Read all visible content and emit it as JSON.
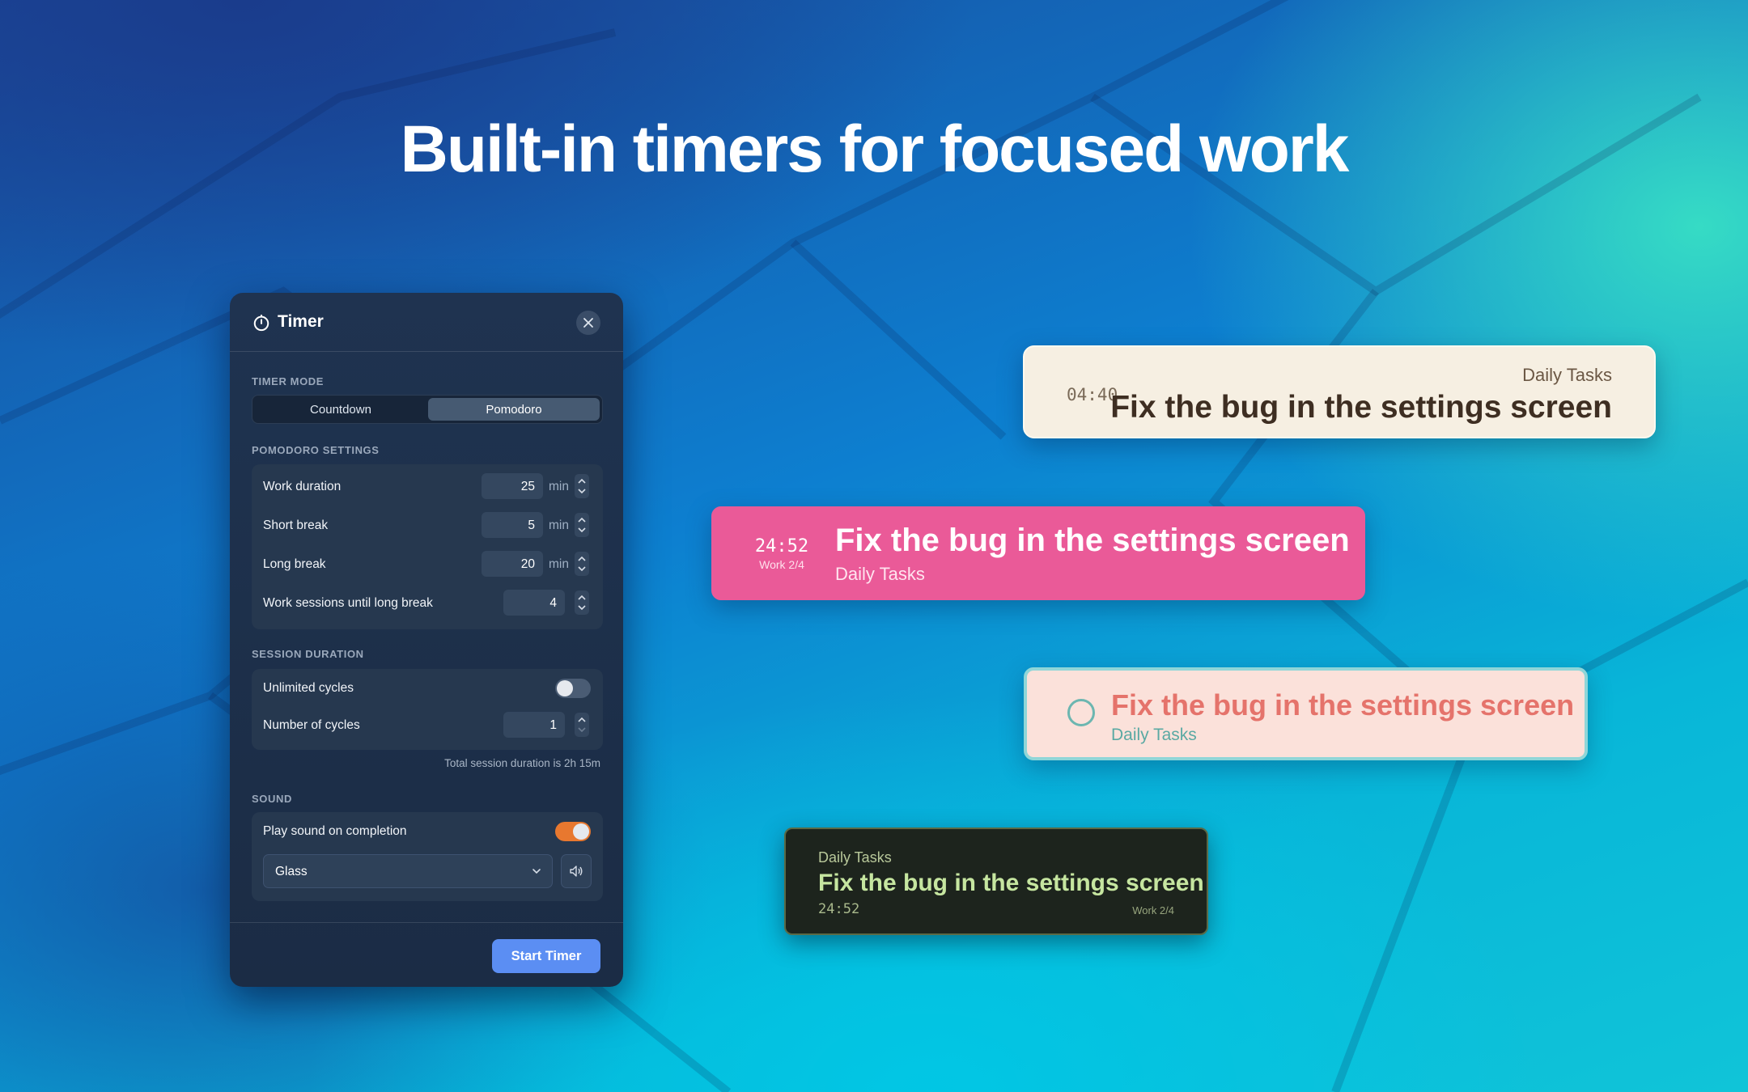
{
  "headline": "Built-in timers for focused work",
  "panel": {
    "title": "Timer",
    "mode_label": "TIMER MODE",
    "modes": [
      "Countdown",
      "Pomodoro"
    ],
    "active_mode": "Pomodoro",
    "pomodoro_label": "POMODORO SETTINGS",
    "work_duration": {
      "label": "Work duration",
      "value": "25",
      "unit": "min"
    },
    "short_break": {
      "label": "Short break",
      "value": "5",
      "unit": "min"
    },
    "long_break": {
      "label": "Long break",
      "value": "20",
      "unit": "min"
    },
    "sessions": {
      "label": "Work sessions until long break",
      "value": "4"
    },
    "session_label": "SESSION DURATION",
    "unlimited": {
      "label": "Unlimited cycles",
      "on": false
    },
    "cycles": {
      "label": "Number of cycles",
      "value": "1"
    },
    "total_hint": "Total session duration is 2h 15m",
    "sound_label": "SOUND",
    "play_sound": {
      "label": "Play sound on completion",
      "on": true
    },
    "sound_choice": "Glass",
    "start_button": "Start Timer"
  },
  "cards": {
    "cream": {
      "timer": "04:40",
      "list": "Daily Tasks",
      "task": "Fix the bug in the settings screen"
    },
    "pink": {
      "timer": "24:52",
      "sub": "Work 2/4",
      "task": "Fix the bug in the settings screen",
      "list": "Daily Tasks"
    },
    "peach": {
      "task": "Fix the bug in the settings screen",
      "list": "Daily Tasks"
    },
    "dark": {
      "list": "Daily Tasks",
      "task": "Fix the bug in the settings screen",
      "timer": "24:52",
      "sub": "Work 2/4"
    }
  },
  "colors": {
    "accent_blue": "#5b8ef3",
    "toggle_on": "#e8782f",
    "pink_card": "#ea5a98",
    "cream_card": "#f6efe2",
    "peach_card": "#fbe1da",
    "dark_card": "#1d241d"
  },
  "icons": [
    "timer-icon",
    "close-icon",
    "chevron-up-icon",
    "chevron-down-icon",
    "speaker-icon",
    "circle-checkbox-icon"
  ]
}
